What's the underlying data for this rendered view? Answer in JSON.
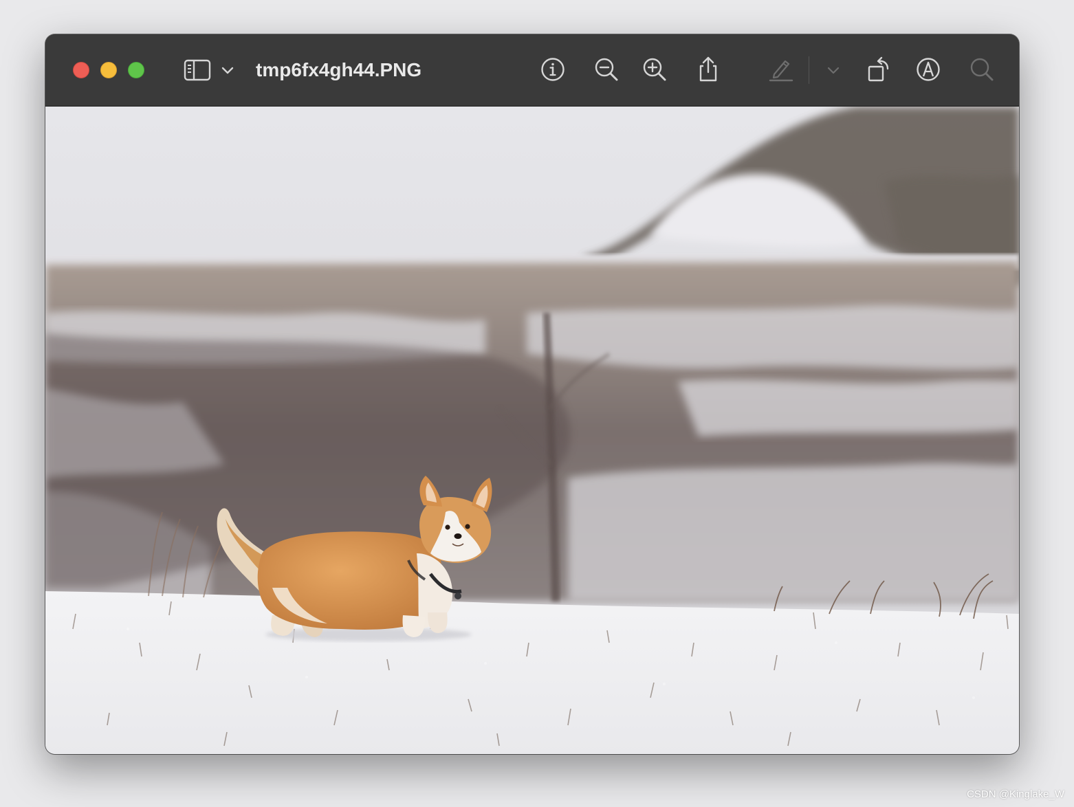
{
  "window": {
    "title": "tmp6fx4gh44.PNG"
  },
  "traffic_lights": {
    "close_color": "#ee5e55",
    "minimize_color": "#f6bd3b",
    "zoom_color": "#5fc44a"
  },
  "toolbar": {
    "icons": [
      "sidebar-toggle-icon",
      "chevron-down-icon",
      "info-icon",
      "zoom-out-icon",
      "zoom-in-icon",
      "share-icon",
      "markup-pen-icon",
      "markup-menu-chevron-icon",
      "rotate-icon",
      "annotate-icon",
      "search-icon"
    ],
    "disabled_icons": [
      "markup-pen-icon",
      "markup-menu-chevron-icon",
      "search-icon"
    ]
  },
  "image": {
    "description_icon": "photo-corgi-in-snow"
  },
  "watermark": "CSDN @Kinglake_W",
  "colors": {
    "titlebar": "#3a3a3a",
    "icon": "#d6d6d6",
    "icon_disabled": "#6e6e6e"
  }
}
